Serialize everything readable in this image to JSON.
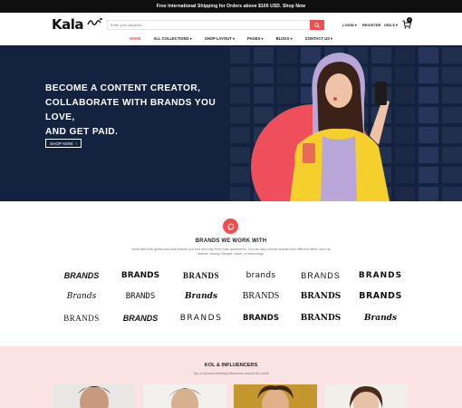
{
  "announcement": "Free International Shipping for Orders above $100 USD. Shop Now",
  "header": {
    "logo": "Kala",
    "logo_script": "ﺍﻻ",
    "search_placeholder": "Enter your keyword ...",
    "login": "LOGIN",
    "register": "REGISTER",
    "currency": "USD $",
    "cart_count": "0"
  },
  "nav": {
    "items": [
      "HOME",
      "ALL COLLECTIONS",
      "SHOP LAYOUT",
      "PAGES",
      "BLOGS",
      "CONTACT US"
    ],
    "active": "HOME"
  },
  "hero": {
    "line1": "BECOME A CONTENT CREATOR,",
    "line2": "COLLABORATE WITH BRANDS YOU LOVE,",
    "line3": "AND GET PAID.",
    "button": "SHOP NOW"
  },
  "brands_section": {
    "title": "BRANDS WE WORK WITH",
    "subtitle": "Work with both global and local brands you love and help them earn awareness. You can also choose brands from different niche, such as fashion, beauty, lifestyle, travel, or technology.",
    "logos": [
      "BRANDS",
      "BRANDS",
      "BRANDS",
      "brands",
      "BRANDS",
      "BRANDS",
      "Brands",
      "BRANDS",
      "Brands",
      "BRANDS",
      "BRANDS",
      "BRANDS",
      "BRANDS",
      "BRANDS",
      "BRANDS",
      "BRANDS",
      "BRANDS",
      "Brands"
    ]
  },
  "kol_section": {
    "title": "KOL & INFLUENCERS",
    "subtitle": "Top on forward-thinking influencers around the world"
  },
  "colors": {
    "accent": "#ef4f4f",
    "hero_bg": "#13223f",
    "kol_bg": "#fbe3e3"
  }
}
